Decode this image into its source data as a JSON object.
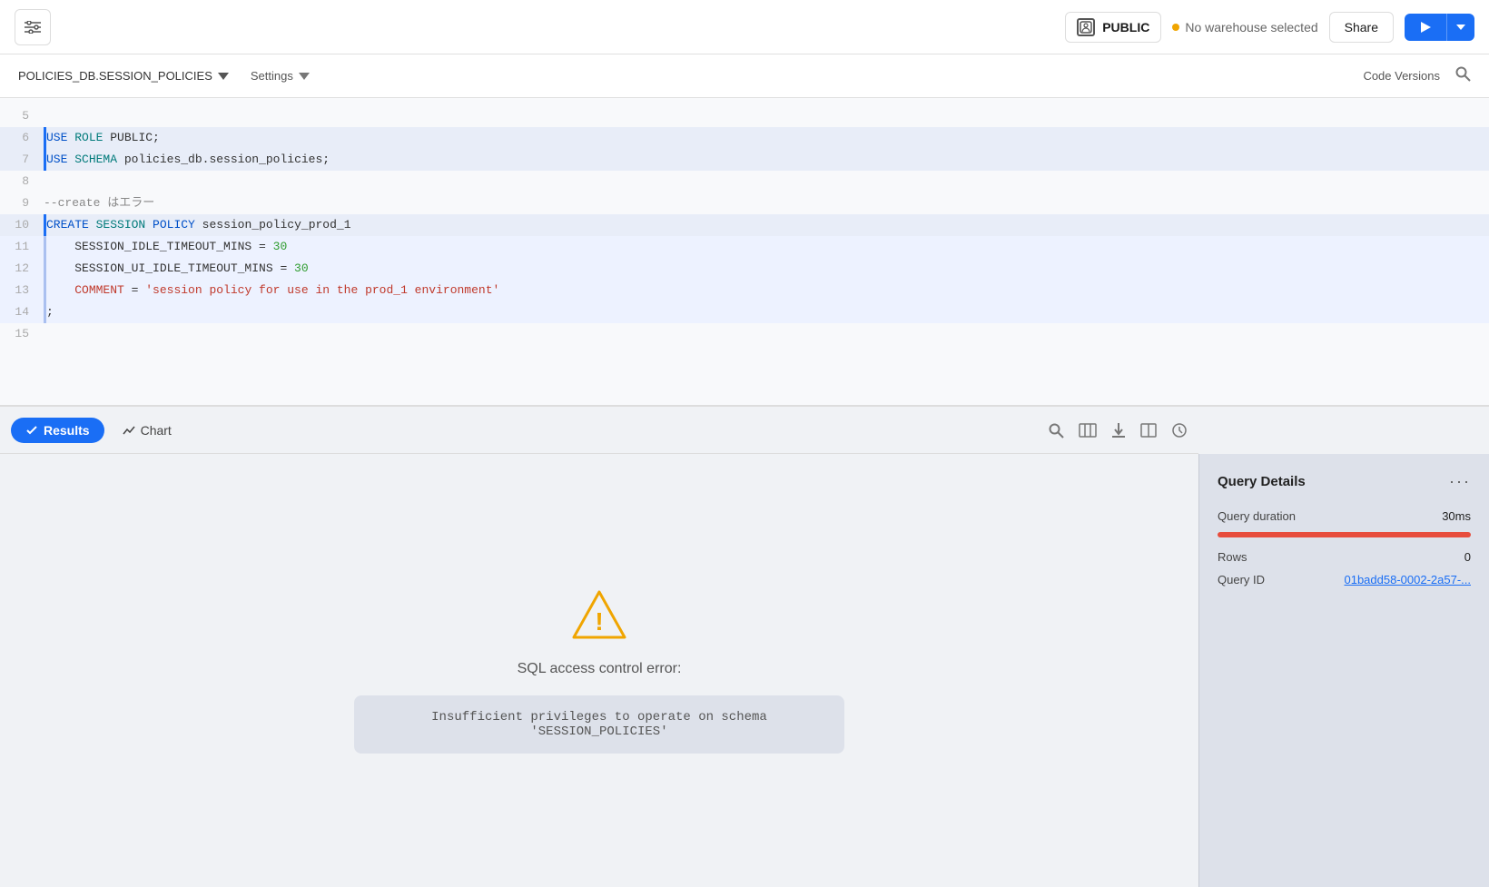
{
  "header": {
    "filter_icon": "≡",
    "role": {
      "icon": "👤",
      "name": "PUBLIC"
    },
    "warehouse": "No warehouse selected",
    "share_label": "Share",
    "run_icon": "▶",
    "dropdown_icon": "▾"
  },
  "toolbar": {
    "db_selector": "POLICIES_DB.SESSION_POLICIES",
    "settings_label": "Settings",
    "code_versions_label": "Code Versions"
  },
  "editor": {
    "lines": [
      {
        "num": "5",
        "content": "",
        "type": "plain",
        "style": ""
      },
      {
        "num": "6",
        "content": "USE ROLE PUBLIC;",
        "type": "code",
        "style": "highlighted"
      },
      {
        "num": "7",
        "content": "USE SCHEMA policies_db.session_policies;",
        "type": "code",
        "style": "highlighted"
      },
      {
        "num": "8",
        "content": "",
        "type": "plain",
        "style": ""
      },
      {
        "num": "9",
        "content": "--create はエラー",
        "type": "comment",
        "style": ""
      },
      {
        "num": "10",
        "content": "CREATE SESSION POLICY session_policy_prod_1",
        "type": "code",
        "style": "highlighted"
      },
      {
        "num": "11",
        "content": "    SESSION_IDLE_TIMEOUT_MINS = 30",
        "type": "code",
        "style": "sub-highlighted"
      },
      {
        "num": "12",
        "content": "    SESSION_UI_IDLE_TIMEOUT_MINS = 30",
        "type": "code",
        "style": "sub-highlighted"
      },
      {
        "num": "13",
        "content": "    COMMENT = 'session policy for use in the prod_1 environment'",
        "type": "code",
        "style": "sub-highlighted"
      },
      {
        "num": "14",
        "content": ";",
        "type": "plain",
        "style": "sub-highlighted"
      },
      {
        "num": "15",
        "content": "",
        "type": "plain",
        "style": ""
      }
    ]
  },
  "tabs": {
    "results_label": "Results",
    "chart_label": "Chart"
  },
  "error": {
    "title": "SQL access control error:",
    "message": "Insufficient privileges to operate on schema 'SESSION_POLICIES'"
  },
  "query_details": {
    "panel_title": "Query Details",
    "duration_label": "Query duration",
    "duration_value": "30ms",
    "rows_label": "Rows",
    "rows_value": "0",
    "query_id_label": "Query ID",
    "query_id_value": "01badd58-0002-2a57-..."
  }
}
